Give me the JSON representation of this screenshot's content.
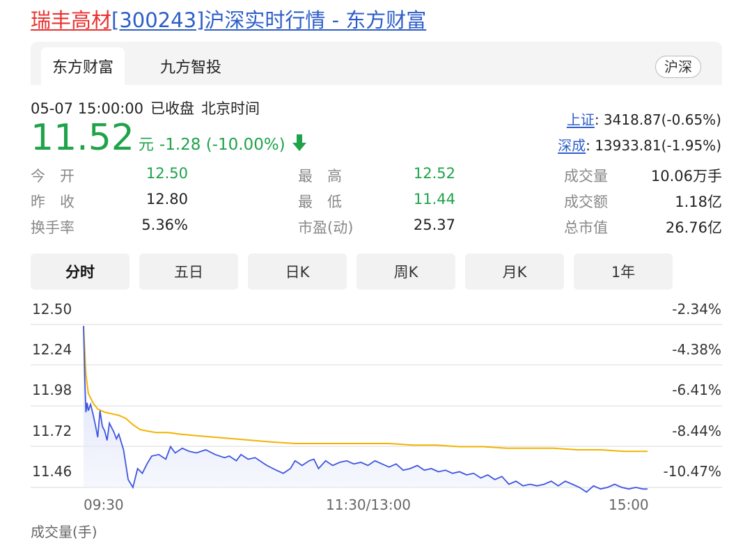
{
  "title": {
    "name": "瑞丰高材",
    "code": "[300243]",
    "rest": "沪深实时行情 - 东方财富"
  },
  "tabs": [
    {
      "label": "东方财富",
      "active": true
    },
    {
      "label": "九方智投",
      "active": false
    }
  ],
  "market_badge": "沪深",
  "quote": {
    "datetime": "05-07 15:00:00",
    "status": "已收盘",
    "timezone": "北京时间",
    "price": "11.52",
    "unit": "元",
    "change": "-1.28 (-10.00%)",
    "arrow_icon": "down-arrow-icon",
    "color": "#1fa34a"
  },
  "indices": [
    {
      "name": "上证",
      "value": ": 3418.87(-0.65%)"
    },
    {
      "name": "深成",
      "value": ": 13933.81(-1.95%)"
    }
  ],
  "stats": [
    [
      {
        "label": "今　开",
        "value": "12.50"
      },
      {
        "label": "最　高",
        "value": "12.52"
      },
      {
        "label": "成交量",
        "value": "10.06万手"
      }
    ],
    [
      {
        "label": "昨　收",
        "value": "12.80"
      },
      {
        "label": "最　低",
        "value": "11.44"
      },
      {
        "label": "成交额",
        "value": "1.18亿"
      }
    ],
    [
      {
        "label": "换手率",
        "value": "5.36%"
      },
      {
        "label": "市盈(动)",
        "value": "25.37"
      },
      {
        "label": "总市值",
        "value": "26.76亿"
      }
    ]
  ],
  "periods": [
    "分时",
    "五日",
    "日K",
    "周K",
    "月K",
    "1年"
  ],
  "active_period": "分时",
  "chart_data": {
    "type": "line",
    "y_left_ticks": [
      "12.50",
      "12.24",
      "11.98",
      "11.72",
      "11.46"
    ],
    "y_right_ticks": [
      "-2.34%",
      "-4.38%",
      "-6.41%",
      "-8.44%",
      "-10.47%"
    ],
    "x_ticks": [
      "09:30",
      "11:30/13:00",
      "15:00"
    ],
    "ylim": [
      11.46,
      12.5
    ],
    "series": [
      {
        "color": "#3e55e0",
        "points": [
          [
            0,
            12.49
          ],
          [
            0.5,
            12.16
          ],
          [
            1,
            11.94
          ],
          [
            1.5,
            12.0
          ],
          [
            2,
            11.95
          ],
          [
            3,
            11.99
          ],
          [
            4,
            11.93
          ],
          [
            5,
            11.86
          ],
          [
            6,
            11.78
          ],
          [
            7,
            11.95
          ],
          [
            8,
            11.85
          ],
          [
            9,
            11.82
          ],
          [
            10,
            11.76
          ],
          [
            11,
            11.87
          ],
          [
            12,
            11.84
          ],
          [
            13,
            11.81
          ],
          [
            14,
            11.77
          ],
          [
            15,
            11.8
          ],
          [
            17,
            11.7
          ],
          [
            19,
            11.51
          ],
          [
            21,
            11.46
          ],
          [
            23,
            11.58
          ],
          [
            25,
            11.55
          ],
          [
            27,
            11.61
          ],
          [
            29,
            11.66
          ],
          [
            32,
            11.67
          ],
          [
            35,
            11.64
          ],
          [
            37,
            11.72
          ],
          [
            39,
            11.68
          ],
          [
            42,
            11.71
          ],
          [
            45,
            11.69
          ],
          [
            48,
            11.68
          ],
          [
            52,
            11.7
          ],
          [
            56,
            11.67
          ],
          [
            60,
            11.65
          ],
          [
            62,
            11.66
          ],
          [
            65,
            11.63
          ],
          [
            67,
            11.67
          ],
          [
            70,
            11.64
          ],
          [
            73,
            11.65
          ],
          [
            75,
            11.63
          ],
          [
            78,
            11.6
          ],
          [
            82,
            11.57
          ],
          [
            85,
            11.55
          ],
          [
            88,
            11.58
          ],
          [
            90,
            11.63
          ],
          [
            93,
            11.6
          ],
          [
            96,
            11.63
          ],
          [
            98,
            11.64
          ],
          [
            100,
            11.58
          ],
          [
            103,
            11.63
          ],
          [
            106,
            11.6
          ],
          [
            109,
            11.62
          ],
          [
            112,
            11.63
          ],
          [
            115,
            11.61
          ],
          [
            118,
            11.62
          ],
          [
            121,
            11.6
          ],
          [
            124,
            11.63
          ],
          [
            127,
            11.61
          ],
          [
            130,
            11.59
          ],
          [
            133,
            11.61
          ],
          [
            136,
            11.57
          ],
          [
            139,
            11.58
          ],
          [
            142,
            11.6
          ],
          [
            145,
            11.57
          ],
          [
            148,
            11.58
          ],
          [
            151,
            11.56
          ],
          [
            154,
            11.57
          ],
          [
            157,
            11.55
          ],
          [
            160,
            11.56
          ],
          [
            163,
            11.54
          ],
          [
            166,
            11.55
          ],
          [
            169,
            11.52
          ],
          [
            172,
            11.54
          ],
          [
            175,
            11.51
          ],
          [
            178,
            11.53
          ],
          [
            181,
            11.48
          ],
          [
            184,
            11.5
          ],
          [
            187,
            11.47
          ],
          [
            190,
            11.48
          ],
          [
            193,
            11.47
          ],
          [
            196,
            11.48
          ],
          [
            199,
            11.5
          ],
          [
            202,
            11.47
          ],
          [
            205,
            11.5
          ],
          [
            208,
            11.48
          ],
          [
            211,
            11.46
          ],
          [
            214,
            11.43
          ],
          [
            217,
            11.47
          ],
          [
            220,
            11.45
          ],
          [
            223,
            11.46
          ],
          [
            226,
            11.48
          ],
          [
            229,
            11.46
          ],
          [
            232,
            11.45
          ],
          [
            235,
            11.46
          ],
          [
            238,
            11.45
          ],
          [
            240,
            11.45
          ]
        ]
      },
      {
        "color": "#f2b300",
        "points": [
          [
            0,
            12.49
          ],
          [
            1,
            12.18
          ],
          [
            2,
            12.06
          ],
          [
            4,
            12.0
          ],
          [
            6,
            11.96
          ],
          [
            9,
            11.94
          ],
          [
            12,
            11.93
          ],
          [
            15,
            11.92
          ],
          [
            18,
            11.9
          ],
          [
            21,
            11.86
          ],
          [
            24,
            11.83
          ],
          [
            27,
            11.82
          ],
          [
            31,
            11.81
          ],
          [
            36,
            11.81
          ],
          [
            41,
            11.8
          ],
          [
            48,
            11.79
          ],
          [
            56,
            11.78
          ],
          [
            64,
            11.77
          ],
          [
            72,
            11.76
          ],
          [
            80,
            11.75
          ],
          [
            90,
            11.74
          ],
          [
            100,
            11.74
          ],
          [
            110,
            11.74
          ],
          [
            120,
            11.74
          ],
          [
            130,
            11.74
          ],
          [
            140,
            11.73
          ],
          [
            150,
            11.73
          ],
          [
            160,
            11.72
          ],
          [
            170,
            11.72
          ],
          [
            180,
            11.71
          ],
          [
            190,
            11.71
          ],
          [
            200,
            11.71
          ],
          [
            210,
            11.7
          ],
          [
            220,
            11.7
          ],
          [
            230,
            11.69
          ],
          [
            240,
            11.69
          ]
        ]
      }
    ]
  },
  "partial_bottom_label": "成交量(手)"
}
